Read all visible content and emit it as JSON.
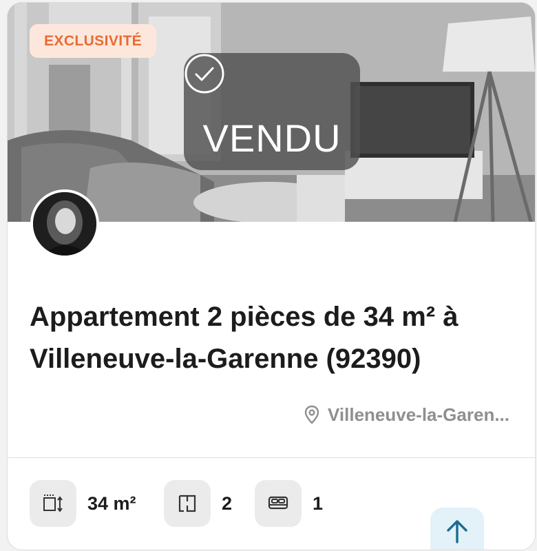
{
  "listing": {
    "badge": "EXCLUSIVITÉ",
    "status": "VENDU",
    "title": "Appartement 2 pièces de 34 m² à Villeneuve-la-Garenne (92390)",
    "location": "Villeneuve-la-Garen..."
  },
  "features": [
    {
      "icon": "surface-icon",
      "value": "34 m²"
    },
    {
      "icon": "rooms-icon",
      "value": "2"
    },
    {
      "icon": "bed-icon",
      "value": "1"
    }
  ],
  "colors": {
    "badge_bg": "#fde7dc",
    "badge_text": "#e86b34",
    "scroll_top_bg": "#e3f1f8",
    "scroll_top_arrow": "#1b6c92"
  }
}
